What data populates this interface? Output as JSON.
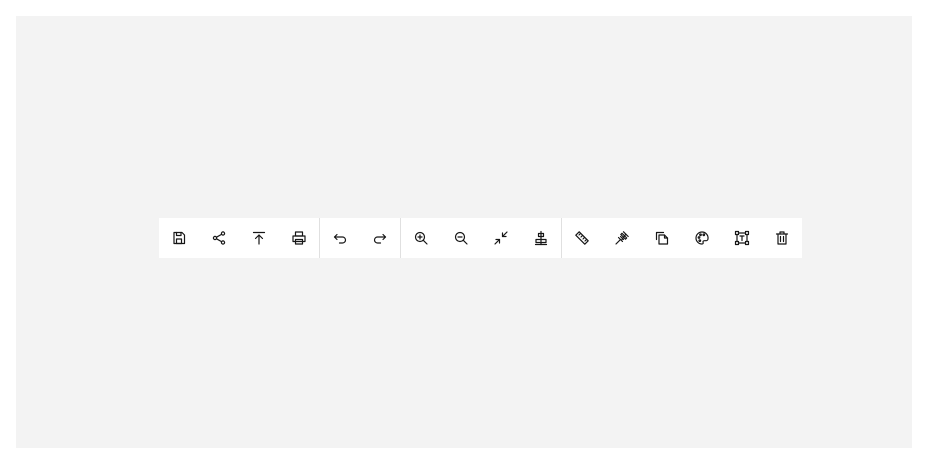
{
  "toolbar": {
    "groups": [
      [
        "save-icon",
        "share-icon",
        "export-icon",
        "print-icon"
      ],
      [
        "undo-icon",
        "redo-icon"
      ],
      [
        "zoom-in-icon",
        "zoom-out-icon",
        "minimize-icon",
        "align-center-icon"
      ],
      [
        "ruler-icon",
        "pin-icon",
        "copy-icon",
        "palette-icon",
        "transform-icon",
        "delete-icon"
      ]
    ]
  },
  "colors": {
    "canvas": "#f3f3f3",
    "toolbar": "#ffffff",
    "icon": "#161616",
    "separator": "#e0e0e0"
  }
}
